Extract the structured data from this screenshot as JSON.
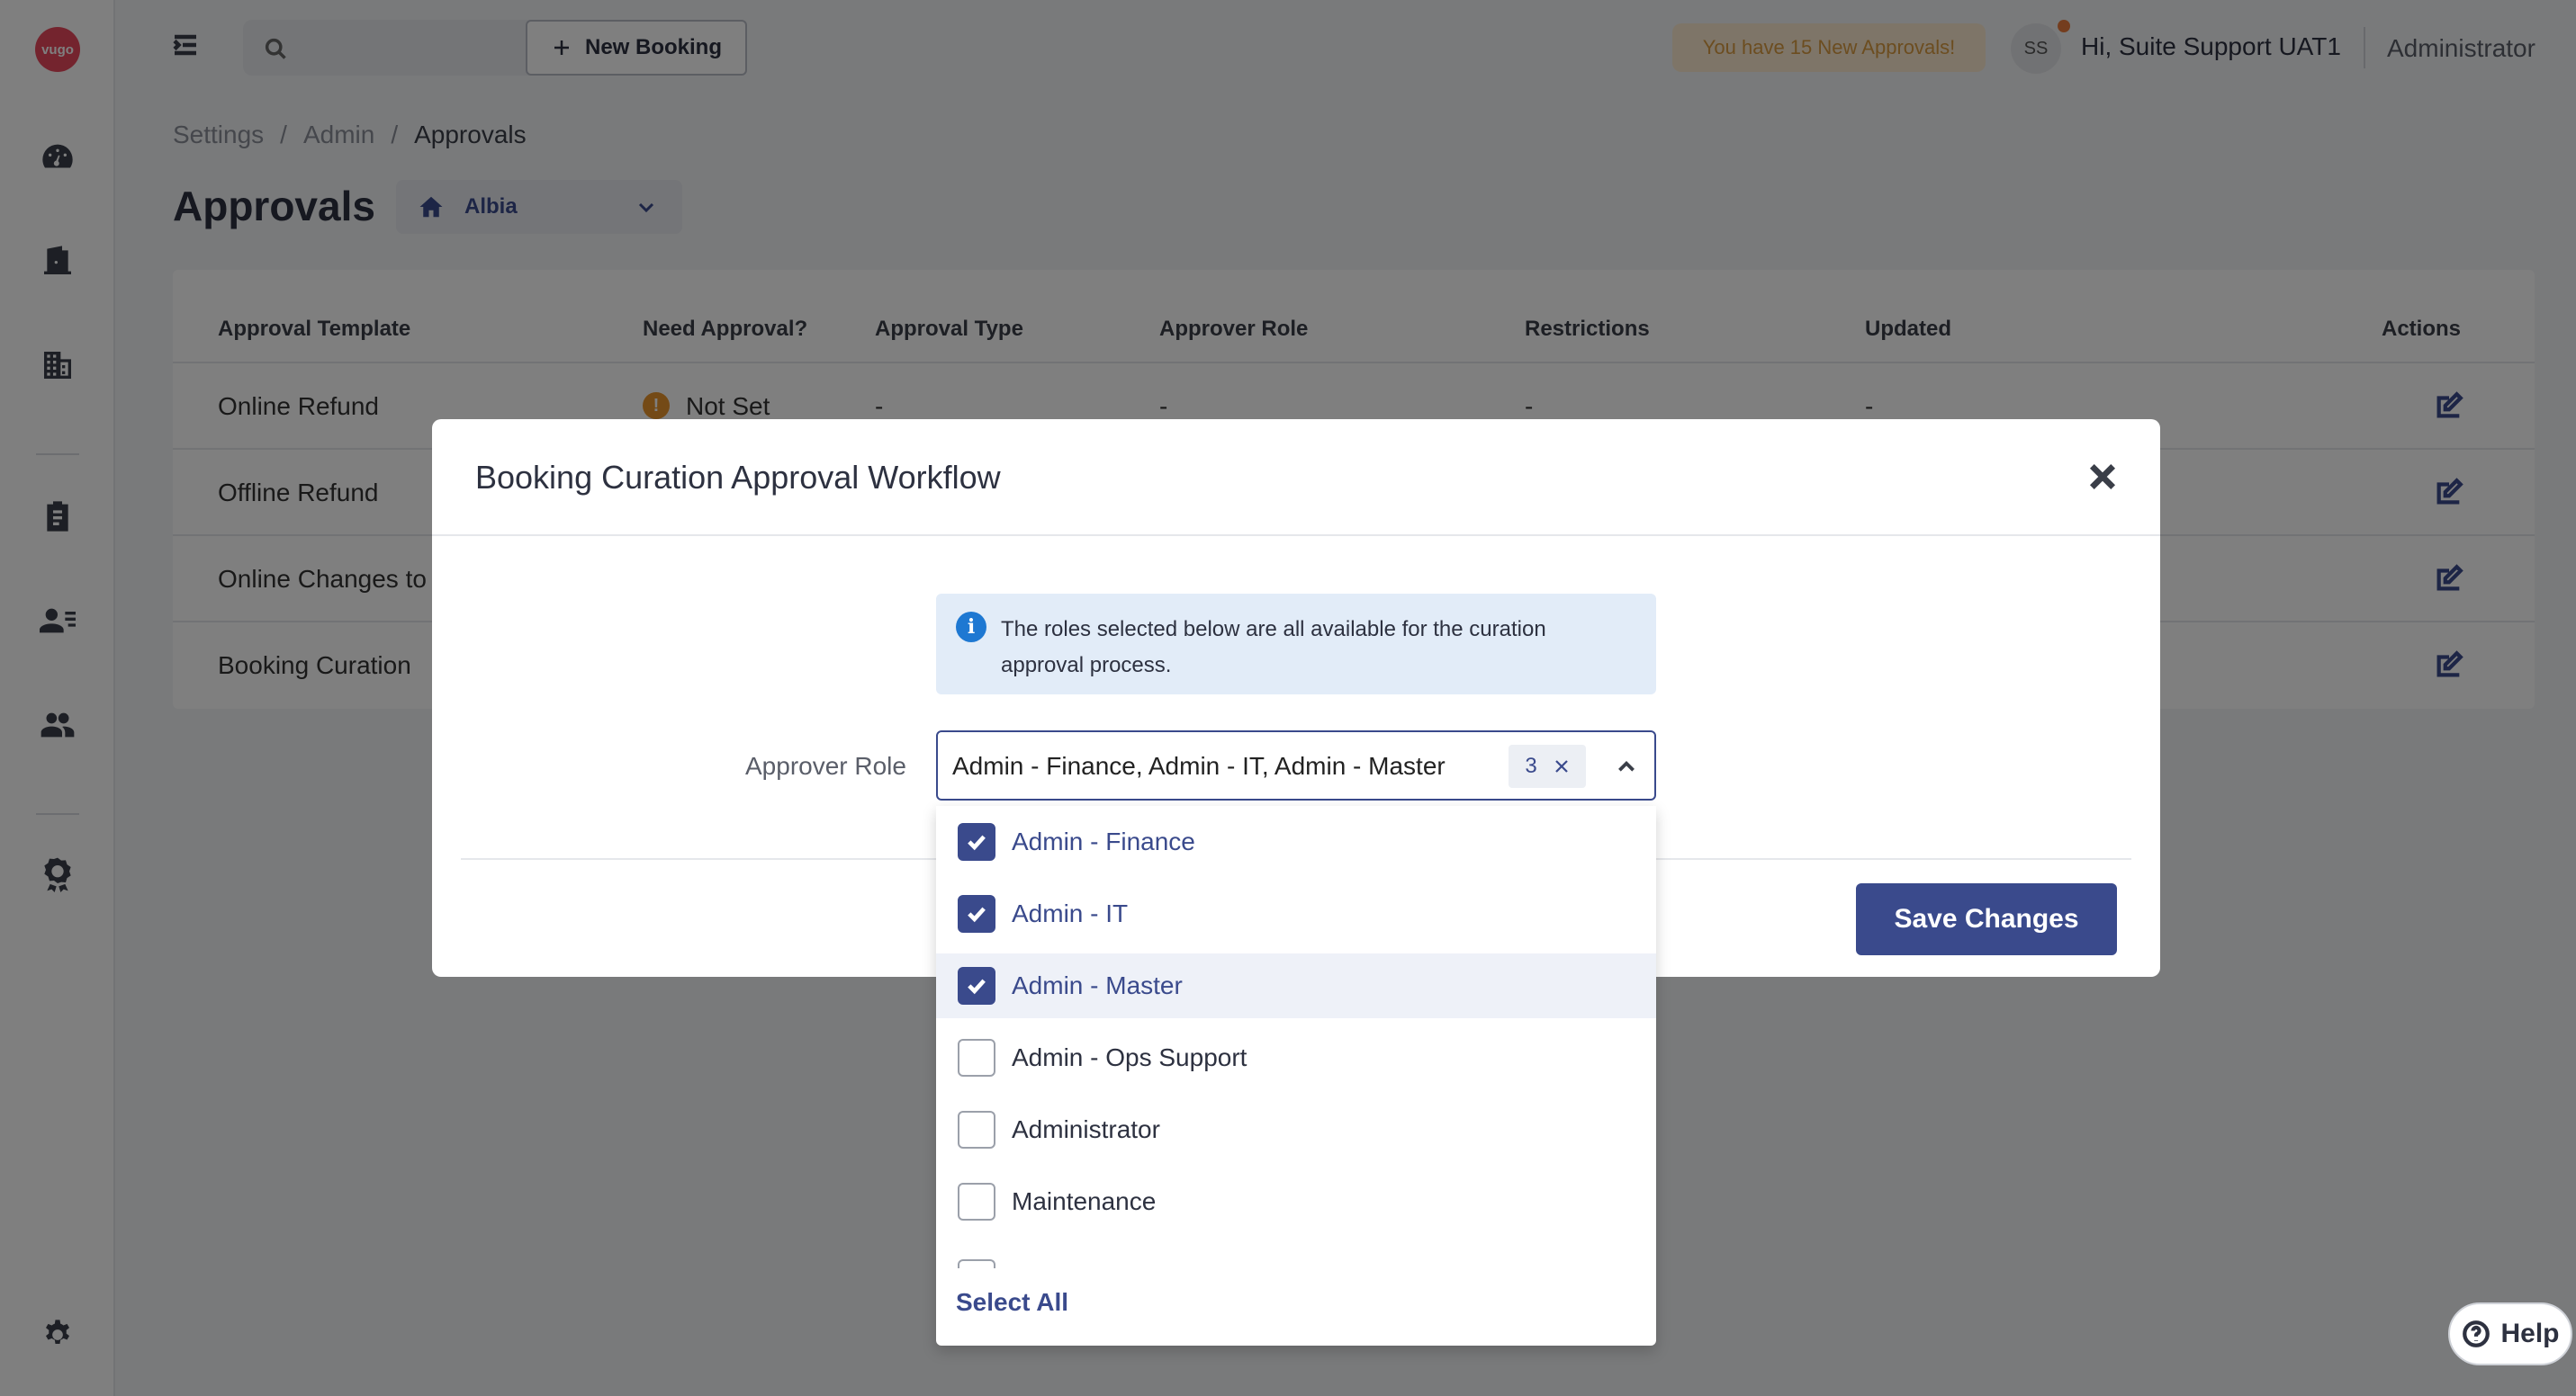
{
  "app": {
    "logo_text": "vugo"
  },
  "header": {
    "new_booking_label": "New Booking",
    "approvals_notice": "You have 15 New Approvals!",
    "avatar_initials": "SS",
    "greeting": "Hi, Suite Support UAT1",
    "role": "Administrator"
  },
  "breadcrumb": [
    "Settings",
    "Admin",
    "Approvals"
  ],
  "page": {
    "title": "Approvals",
    "location": "Albia"
  },
  "table": {
    "columns": [
      "Approval Template",
      "Need Approval?",
      "Approval Type",
      "Approver Role",
      "Restrictions",
      "Updated",
      "Actions"
    ],
    "rows": [
      {
        "template": "Online Refund",
        "need_approval": "Not Set",
        "type": "-",
        "role": "-",
        "restrictions": "-",
        "updated": "-"
      },
      {
        "template": "Offline Refund"
      },
      {
        "template": "Online Changes to"
      },
      {
        "template": "Booking Curation"
      }
    ]
  },
  "modal": {
    "title": "Booking Curation Approval Workflow",
    "info": "The roles selected below are all available for the curation approval process.",
    "field_label": "Approver Role",
    "selected_value": "Admin - Finance, Admin - IT, Admin - Master",
    "selected_count": "3",
    "save_label": "Save Changes"
  },
  "dropdown": {
    "options": [
      {
        "label": "Admin - Finance",
        "checked": true
      },
      {
        "label": "Admin - IT",
        "checked": true
      },
      {
        "label": "Admin - Master",
        "checked": true
      },
      {
        "label": "Admin - Ops Support",
        "checked": false
      },
      {
        "label": "Administrator",
        "checked": false
      },
      {
        "label": "Maintenance",
        "checked": false
      }
    ],
    "select_all_label": "Select All"
  },
  "help": {
    "label": "Help"
  },
  "colors": {
    "primary": "#3a4a8c",
    "info_bg": "#e2ecf8",
    "warning": "#e8952d"
  }
}
